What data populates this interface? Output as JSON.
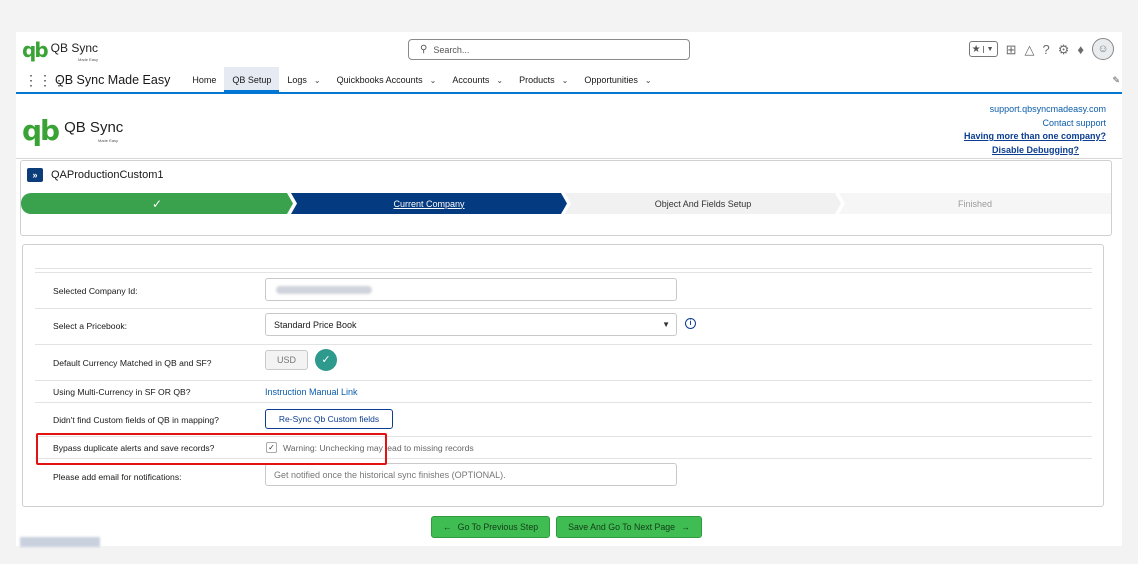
{
  "header": {
    "logo_mark": "qb",
    "logo_text": "QB Sync",
    "logo_sub": "Made Easy",
    "search_placeholder": "Search...",
    "search_icon": "search-icon",
    "utility_icons": [
      "favorites-star-icon",
      "add-icon",
      "help-trail-icon",
      "question-icon",
      "setup-gear-icon",
      "notification-bell-icon",
      "avatar-icon"
    ]
  },
  "nav": {
    "app_name": "QB Sync Made Easy",
    "items": [
      {
        "label": "Home",
        "dropdown": false,
        "active": false
      },
      {
        "label": "QB Setup",
        "dropdown": false,
        "active": true
      },
      {
        "label": "Logs",
        "dropdown": true,
        "active": false
      },
      {
        "label": "Quickbooks Accounts",
        "dropdown": true,
        "active": false
      },
      {
        "label": "Accounts",
        "dropdown": true,
        "active": false
      },
      {
        "label": "Products",
        "dropdown": true,
        "active": false
      },
      {
        "label": "Opportunities",
        "dropdown": true,
        "active": false
      }
    ]
  },
  "brand": {
    "logo_mark": "qb",
    "logo_text": "QB Sync",
    "logo_sub": "Made Easy"
  },
  "support_links": {
    "site": "support.qbsyncmadeasy.com",
    "contact": "Contact support",
    "multi_company": "Having more than one company?",
    "debugging": "Disable Debugging?"
  },
  "record": {
    "icon_text": "»",
    "name": "QAProductionCustom1"
  },
  "path": {
    "steps": [
      {
        "label": "✓",
        "state": "complete"
      },
      {
        "label": "Current Company",
        "state": "current"
      },
      {
        "label": "Object And Fields Setup",
        "state": "incomplete"
      },
      {
        "label": "Finished",
        "state": "disabled"
      }
    ]
  },
  "form": {
    "company_id": {
      "label": "Selected Company Id:",
      "value_blurred": true
    },
    "pricebook": {
      "label": "Select a Pricebook:",
      "value": "Standard Price Book",
      "info_icon": "i"
    },
    "currency": {
      "label": "Default Currency Matched in QB and SF?",
      "value": "USD",
      "matched_icon": "✓"
    },
    "multi_currency": {
      "label": "Using Multi-Currency in SF OR QB?",
      "link": "Instruction Manual Link"
    },
    "custom_fields": {
      "label": "Didn't find Custom fields of QB in mapping?",
      "button": "Re-Sync Qb Custom fields"
    },
    "bypass": {
      "label": "Bypass duplicate alerts and save records?",
      "checked": true,
      "warning": "Warning: Unchecking may lead to missing records"
    },
    "email": {
      "label": "Please add email for notifications:",
      "placeholder": "Get notified once the historical sync finishes (OPTIONAL)."
    }
  },
  "actions": {
    "previous": "Go To Previous Step",
    "next": "Save And Go To Next Page"
  },
  "colors": {
    "accent": "#0176d3",
    "path_complete": "#3aa14d",
    "path_current": "#043a80",
    "button_green": "#3fbd52",
    "highlight_red": "#e01212"
  }
}
